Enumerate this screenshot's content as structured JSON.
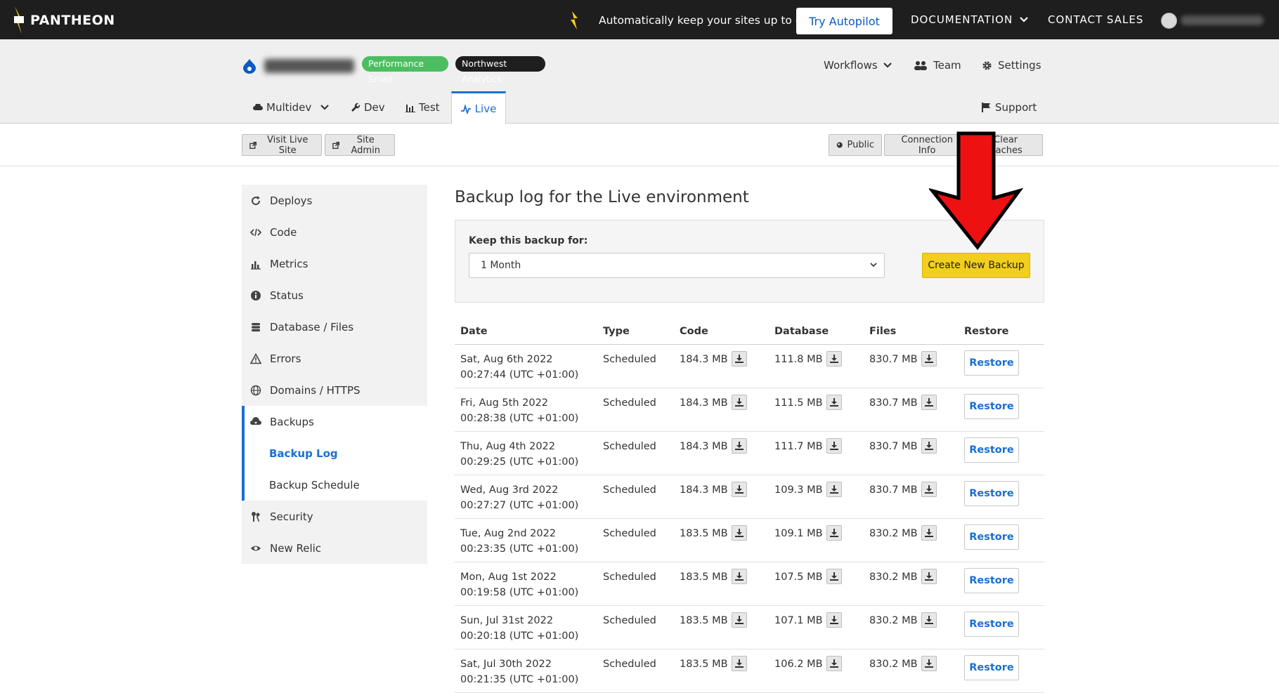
{
  "topbar": {
    "brand": "PANTHEON",
    "promo_text": "Automatically keep your sites up to date!",
    "try_button": "Try Autopilot",
    "documentation": "DOCUMENTATION",
    "contact_sales": "CONTACT SALES"
  },
  "site": {
    "badge_plan": "Performance Small",
    "badge_org": "Northwest Analytics",
    "workflows": "Workflows",
    "team": "Team",
    "settings": "Settings"
  },
  "env_tabs": {
    "multidev": "Multidev",
    "dev": "Dev",
    "test": "Test",
    "live": "Live",
    "support": "Support"
  },
  "actions": {
    "visit_live_site": "Visit Live Site",
    "site_admin": "Site Admin",
    "public": "Public",
    "connection_info": "Connection Info",
    "clear_caches": "Clear Caches"
  },
  "sidebar": {
    "items": [
      {
        "label": "Deploys"
      },
      {
        "label": "Code"
      },
      {
        "label": "Metrics"
      },
      {
        "label": "Status"
      },
      {
        "label": "Database / Files"
      },
      {
        "label": "Errors"
      },
      {
        "label": "Domains / HTTPS"
      }
    ],
    "backups": "Backups",
    "backup_log": "Backup Log",
    "backup_schedule": "Backup Schedule",
    "security": "Security",
    "new_relic": "New Relic"
  },
  "main": {
    "title": "Backup log for the Live environment",
    "keep_label": "Keep this backup for:",
    "keep_value": "1 Month",
    "create_button": "Create New Backup"
  },
  "table": {
    "headers": [
      "Date",
      "Type",
      "Code",
      "Database",
      "Files",
      "Restore"
    ],
    "restore_label": "Restore",
    "rows": [
      {
        "date1": "Sat, Aug 6th 2022",
        "date2": "00:27:44 (UTC +01:00)",
        "type": "Scheduled",
        "code": "184.3 MB",
        "database": "111.8 MB",
        "files": "830.7 MB"
      },
      {
        "date1": "Fri, Aug 5th 2022",
        "date2": "00:28:38 (UTC +01:00)",
        "type": "Scheduled",
        "code": "184.3 MB",
        "database": "111.5 MB",
        "files": "830.7 MB"
      },
      {
        "date1": "Thu, Aug 4th 2022",
        "date2": "00:29:25 (UTC +01:00)",
        "type": "Scheduled",
        "code": "184.3 MB",
        "database": "111.7 MB",
        "files": "830.7 MB"
      },
      {
        "date1": "Wed, Aug 3rd 2022",
        "date2": "00:27:27 (UTC +01:00)",
        "type": "Scheduled",
        "code": "184.3 MB",
        "database": "109.3 MB",
        "files": "830.7 MB"
      },
      {
        "date1": "Tue, Aug 2nd 2022",
        "date2": "00:23:35 (UTC +01:00)",
        "type": "Scheduled",
        "code": "183.5 MB",
        "database": "109.1 MB",
        "files": "830.2 MB"
      },
      {
        "date1": "Mon, Aug 1st 2022",
        "date2": "00:19:58 (UTC +01:00)",
        "type": "Scheduled",
        "code": "183.5 MB",
        "database": "107.5 MB",
        "files": "830.2 MB"
      },
      {
        "date1": "Sun, Jul 31st 2022",
        "date2": "00:20:18 (UTC +01:00)",
        "type": "Scheduled",
        "code": "183.5 MB",
        "database": "107.1 MB",
        "files": "830.2 MB"
      },
      {
        "date1": "Sat, Jul 30th 2022",
        "date2": "00:21:35 (UTC +01:00)",
        "type": "Scheduled",
        "code": "183.5 MB",
        "database": "106.2 MB",
        "files": "830.2 MB"
      }
    ]
  },
  "colors": {
    "accent": "#1a6fd1",
    "topbar": "#1e1e1e",
    "create_button": "#f2ce1f",
    "arrow": "#ee1111"
  }
}
